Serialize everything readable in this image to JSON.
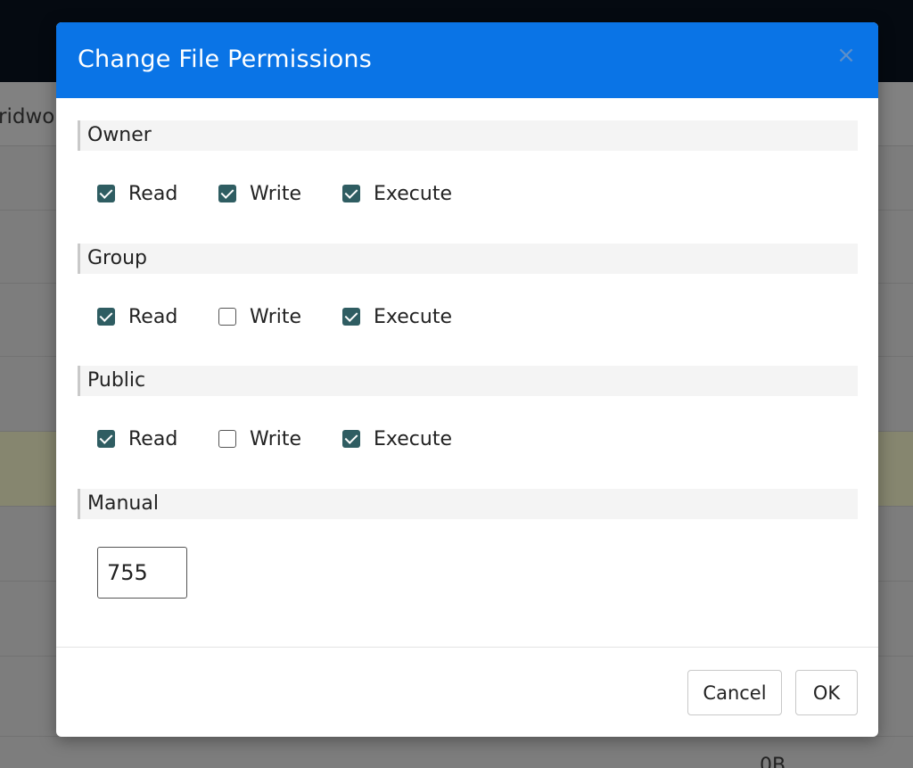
{
  "background": {
    "crumb_fragment": "ridwo",
    "size_fragment": "0B"
  },
  "dialog": {
    "title": "Change File Permissions",
    "close_symbol": "×",
    "sections": {
      "owner": {
        "title": "Owner",
        "read": {
          "label": "Read",
          "checked": true
        },
        "write": {
          "label": "Write",
          "checked": true
        },
        "execute": {
          "label": "Execute",
          "checked": true
        }
      },
      "group": {
        "title": "Group",
        "read": {
          "label": "Read",
          "checked": true
        },
        "write": {
          "label": "Write",
          "checked": false
        },
        "execute": {
          "label": "Execute",
          "checked": true
        }
      },
      "public": {
        "title": "Public",
        "read": {
          "label": "Read",
          "checked": true
        },
        "write": {
          "label": "Write",
          "checked": false
        },
        "execute": {
          "label": "Execute",
          "checked": true
        }
      }
    },
    "manual": {
      "title": "Manual",
      "value": "755"
    },
    "buttons": {
      "cancel": "Cancel",
      "ok": "OK"
    }
  },
  "colors": {
    "header": "#0a74e6",
    "checkbox_checked": "#2f5d62",
    "topbar": "#050a11"
  }
}
